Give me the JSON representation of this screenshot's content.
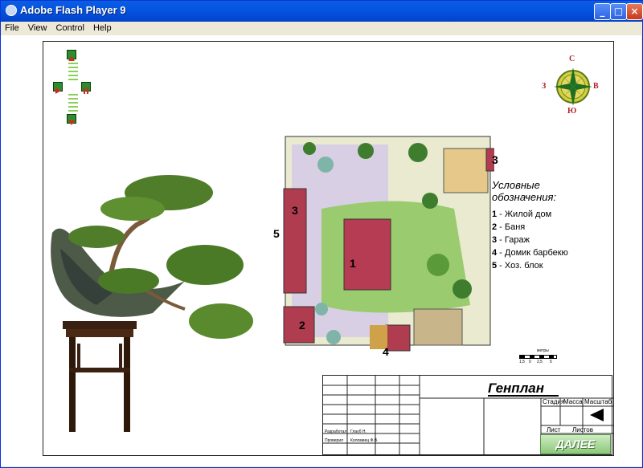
{
  "window": {
    "title": "Adobe Flash Player 9",
    "buttons": {
      "minimize": "_",
      "maximize": "□",
      "close": "×"
    }
  },
  "menu": {
    "items": [
      "File",
      "View",
      "Control",
      "Help"
    ]
  },
  "compass": {
    "north": "С",
    "south": "Ю",
    "west": "З",
    "east": "В"
  },
  "plan": {
    "markers": [
      "1",
      "2",
      "3",
      "3",
      "4",
      "5"
    ]
  },
  "legend": {
    "title_line1": "Условные",
    "title_line2": "обозначения:",
    "items": [
      {
        "num": "1",
        "text": " - Жилой дом"
      },
      {
        "num": "2",
        "text": " - Баня"
      },
      {
        "num": "3",
        "text": " - Гараж"
      },
      {
        "num": "4",
        "text": " - Домик барбекю"
      },
      {
        "num": "5",
        "text": " - Хоз. блок"
      }
    ]
  },
  "scale_bar": {
    "label": "метры",
    "ticks": [
      "1,5",
      "0",
      "2,5",
      "5"
    ]
  },
  "title_block": {
    "title": "Генплан",
    "stage_label": "Стадия",
    "mass_label": "Масса",
    "scale_label": "Масштаб",
    "sheet_label": "Лист",
    "sheets_label": "Листов",
    "developed_label": "Разработал",
    "developed_name": "Глауб Н.",
    "checked_label": "Проверил",
    "checked_name": "Коломиец Ф.В."
  },
  "next_button": {
    "label": "ДАЛЕЕ"
  },
  "colors": {
    "title_bar": "#0554e3",
    "accent_green": "#2e8b2e",
    "compass_red": "#b0232a",
    "next_button": "#8cc77b"
  }
}
